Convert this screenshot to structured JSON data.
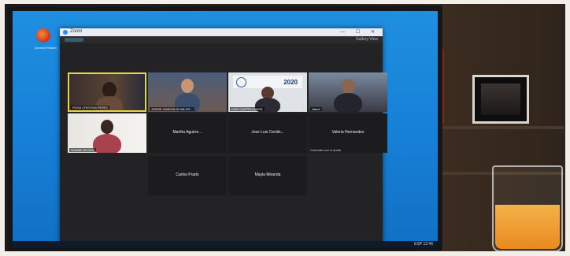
{
  "window": {
    "title": "Zoom",
    "controls": "— ☐ ✕",
    "view_label": "Gallery View"
  },
  "desktop": {
    "icon_label": "Acrobat Reader"
  },
  "participants": [
    {
      "name": "ROSA CRISTINA PEREZ",
      "style": "video",
      "active": true
    },
    {
      "name": "JORGE GARCIA OLIVA CR...",
      "style": "video",
      "active": false
    },
    {
      "name": "LINO CASTELLANOS",
      "style": "video-banner",
      "active": false,
      "banner_year": "2020"
    },
    {
      "name": "Jaime",
      "style": "video",
      "active": false
    },
    {
      "name": "HUANE 18 2019",
      "style": "video",
      "active": false
    },
    {
      "name": "Martha Aguirre...",
      "style": "name-only",
      "active": false
    },
    {
      "name": "Jose Luis Cerdin...",
      "style": "name-only",
      "active": false
    },
    {
      "name": "Valeria Hernandez",
      "style": "name-only",
      "active": false,
      "note": "Conectar con el audio"
    },
    {
      "name": "Carlos Prado",
      "style": "name-only",
      "active": false
    },
    {
      "name": "Mayla Miranda",
      "style": "name-only",
      "active": false
    }
  ],
  "taskbar": {
    "tray_text": "ESP 12:46"
  },
  "colors": {
    "desktop_blue": "#1f8fe0",
    "app_bg": "#232325",
    "active_speaker_border": "#e3d64a",
    "juice": "#f6b14a"
  }
}
